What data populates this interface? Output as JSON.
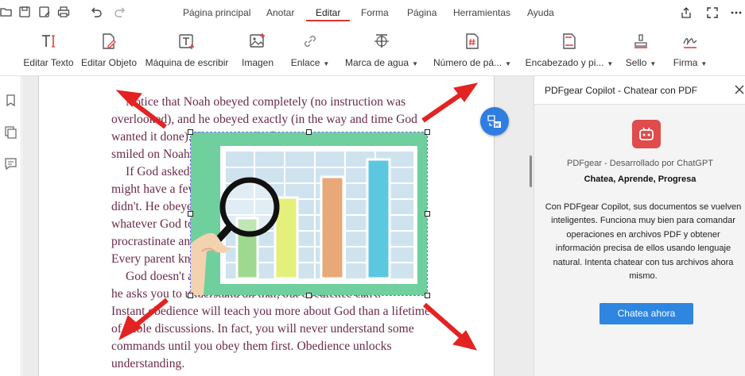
{
  "menubar": {
    "quick_access_icons": [
      "open-folder-icon",
      "save-icon",
      "save-as-icon",
      "print-icon",
      "undo-icon",
      "redo-icon"
    ],
    "tabs": [
      {
        "label": "Página principal",
        "active": false
      },
      {
        "label": "Anotar",
        "active": false
      },
      {
        "label": "Editar",
        "active": true
      },
      {
        "label": "Forma",
        "active": false
      },
      {
        "label": "Página",
        "active": false
      },
      {
        "label": "Herramientas",
        "active": false
      },
      {
        "label": "Ayuda",
        "active": false
      }
    ],
    "window_icons": [
      "share-icon",
      "fullscreen-icon",
      "more-icon"
    ],
    "accent_color": "#dd3333"
  },
  "ribbon": {
    "tools": [
      {
        "label": "Editar Texto",
        "icon": "edit-text-icon",
        "dropdown": false
      },
      {
        "label": "Editar Objeto",
        "icon": "edit-object-icon",
        "dropdown": false
      },
      {
        "label": "Máquina de escribir",
        "icon": "typewriter-icon",
        "dropdown": false
      },
      {
        "label": "Imagen",
        "icon": "image-icon",
        "dropdown": false
      },
      {
        "label": "Enlace",
        "icon": "link-icon",
        "dropdown": true
      },
      {
        "label": "Marca de agua",
        "icon": "watermark-icon",
        "dropdown": true
      },
      {
        "label": "Número de pá...",
        "icon": "page-number-icon",
        "dropdown": true
      },
      {
        "label": "Encabezado y pi...",
        "icon": "header-footer-icon",
        "dropdown": true
      },
      {
        "label": "Sello",
        "icon": "stamp-icon",
        "dropdown": true
      },
      {
        "label": "Firma",
        "icon": "signature-icon",
        "dropdown": true
      }
    ]
  },
  "left_strip": {
    "icons": [
      "bookmark-icon",
      "pages-icon",
      "comment-icon"
    ]
  },
  "document": {
    "paragraphs": [
      {
        "lines": [
          "Notice that Noah obeyed completely (no instruction was",
          "overlooked), and he obeyed exactly (in the way and time God",
          "wanted it done). No wonder God",
          "smiled on Noah."
        ]
      },
      {
        "lines": [
          "If God asked you to do something, you",
          "might have a few reasons why Noah",
          "didn't. He obeyed God and did",
          "whatever God told him. He didn't",
          "procrastinate and say, \"I'll do it, just let delay.",
          "Every parent knows that delayed obedience."
        ]
      },
      {
        "lines": [
          "God doesn't ask you to do everything",
          "he asks you to understand all that, but obedience can't.",
          "Instant obedience will teach you more about God than a lifetime",
          "of Bible discussions. In fact, you will never understand some",
          "commands until you obey them first. Obedience unlocks",
          "understanding."
        ]
      }
    ],
    "text_color": "#6b2a4a",
    "selected_image": {
      "icon": "chart-magnifier-illustration",
      "bar_colors": [
        "#9fd98f",
        "#e4f07a",
        "#e8a877",
        "#5cc8e0"
      ],
      "background_color": "#6fcf9d"
    },
    "annotation_arrow_color": "#e32222"
  },
  "floating_button": {
    "icon": "convert-to-word-icon",
    "color": "#2f7de1"
  },
  "copilot": {
    "title": "PDFgear Copilot - Chatear con PDF",
    "logo_icon": "robot-logo-icon",
    "subtitle": "PDFgear - Desarrollado por ChatGPT",
    "tagline": "Chatea, Aprende, Progresa",
    "description": "Con PDFgear Copilot, sus documentos se vuelven inteligentes.  Funciona muy bien para comandar operaciones en archivos PDF y obtener información precisa de ellos usando lenguaje natural.  Intenta chatear con tus archivos ahora mismo.",
    "button_label": "Chatea ahora",
    "button_color": "#2f86e0"
  }
}
